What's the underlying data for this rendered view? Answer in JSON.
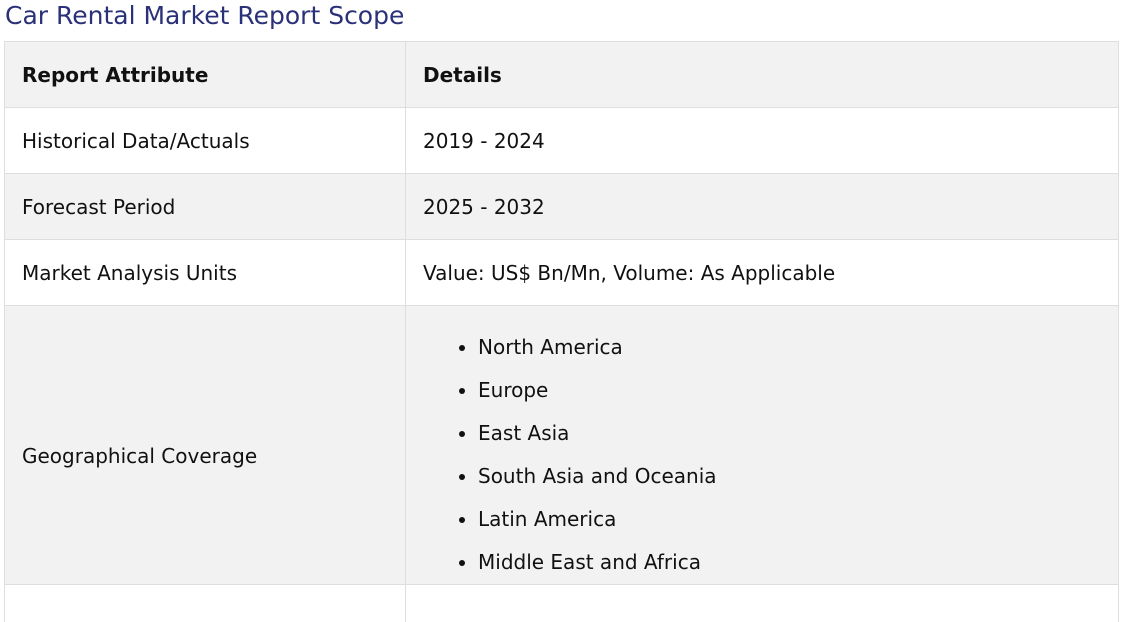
{
  "title": "Car Rental Market Report Scope",
  "table": {
    "headers": [
      "Report Attribute",
      "Details"
    ],
    "rows": [
      {
        "attribute": "Historical Data/Actuals",
        "details": "2019 - 2024"
      },
      {
        "attribute": "Forecast Period",
        "details": "2025 - 2032"
      },
      {
        "attribute": "Market Analysis Units",
        "details": "Value: US$ Bn/Mn, Volume: As Applicable"
      }
    ],
    "geo": {
      "attribute": "Geographical Coverage",
      "regions": [
        "North America",
        "Europe",
        "East Asia",
        "South Asia and Oceania",
        "Latin America",
        "Middle East and Africa"
      ]
    }
  }
}
